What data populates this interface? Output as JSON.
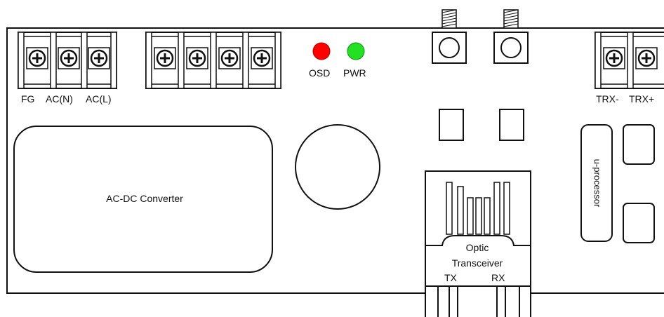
{
  "terminals": {
    "fg": "FG",
    "ac_n": "AC(N)",
    "ac_l": "AC(L)",
    "trx_minus": "TRX-",
    "trx_plus": "TRX+"
  },
  "leds": {
    "osd": "OSD",
    "pwr": "PWR",
    "osd_color": "#ff0000",
    "pwr_color": "#22e022"
  },
  "blocks": {
    "converter": "AC-DC Converter",
    "uprocessor": "u-processor"
  },
  "optic": {
    "line1": "Optic",
    "line2": "Transceiver",
    "tx": "TX",
    "rx": "RX"
  },
  "colors": {
    "stroke": "#111111",
    "fill": "#ffffff"
  }
}
